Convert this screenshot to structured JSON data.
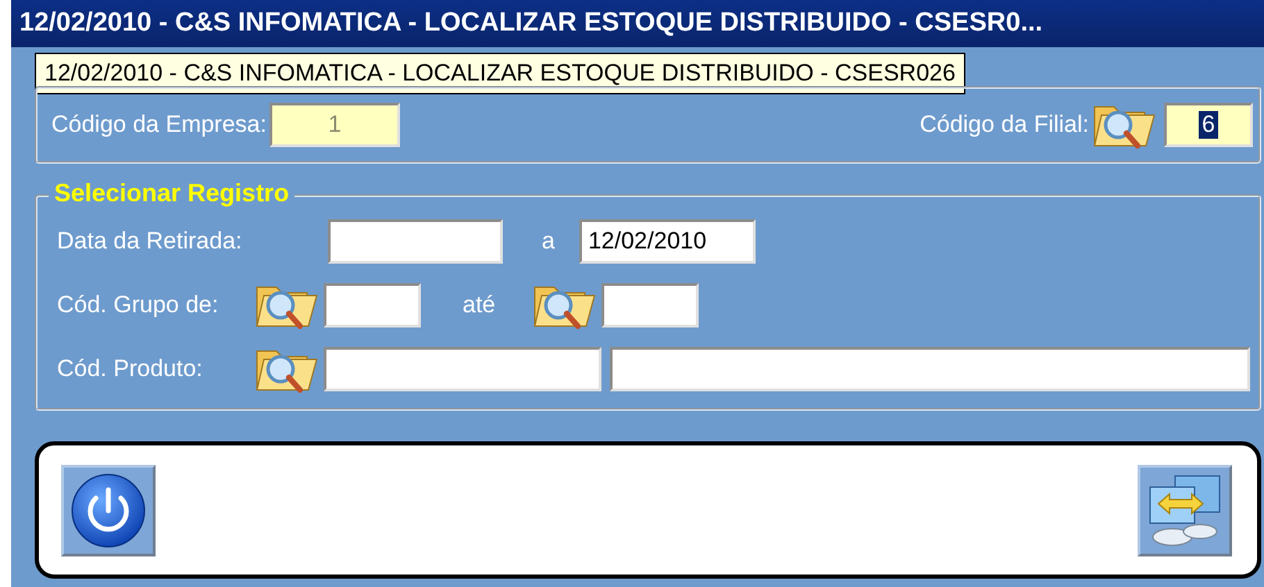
{
  "window": {
    "title": "12/02/2010  -  C&S INFOMATICA  -  LOCALIZAR ESTOQUE DISTRIBUIDO  -  CSESR0..."
  },
  "tooltip": {
    "text": "12/02/2010  -  C&S INFOMATICA  -  LOCALIZAR ESTOQUE DISTRIBUIDO  -  CSESR026"
  },
  "empresa": {
    "company_label": "Código da Empresa:",
    "company_value": "1",
    "branch_label": "Código da Filial:",
    "branch_value": "6",
    "branch_value_selected": true
  },
  "selecionar": {
    "title": "Selecionar Registro",
    "rows": [
      {
        "kind": "date",
        "label": "Data da Retirada:",
        "from": "",
        "separator": "a",
        "to": "12/02/2010"
      },
      {
        "kind": "group",
        "label": "Cód. Grupo de:",
        "from": "",
        "separator": "até",
        "to": ""
      },
      {
        "kind": "product",
        "label": "Cód. Produto:",
        "code": "",
        "description": ""
      }
    ]
  }
}
